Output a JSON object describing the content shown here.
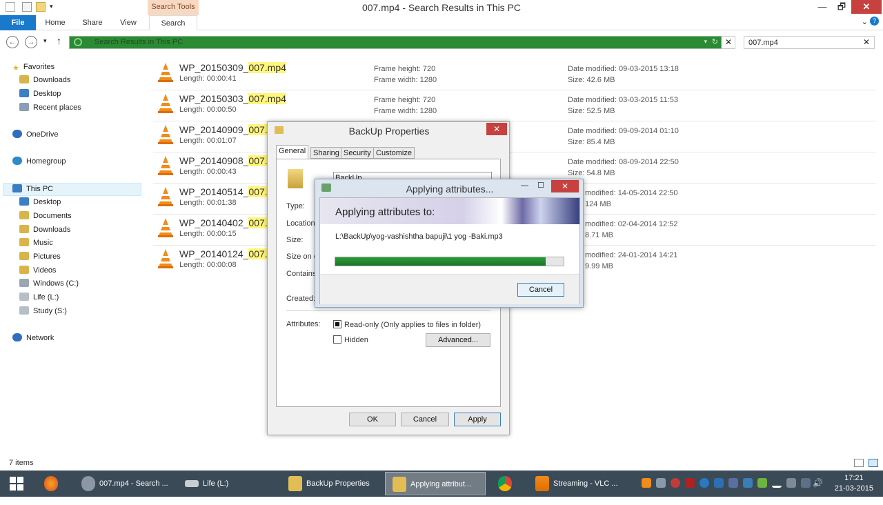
{
  "window": {
    "title": "007.mp4 - Search Results in This PC"
  },
  "ribbon": {
    "context_tab": "Search Tools",
    "tabs": [
      "File",
      "Home",
      "Share",
      "View",
      "Search"
    ]
  },
  "window_controls": {
    "minimize": "—",
    "maximize": "🗗",
    "close": "✕"
  },
  "address": {
    "path": "Search Results in This PC",
    "search_value": "007.mp4",
    "clear_glyph": "✕"
  },
  "nav": {
    "favorites": "Favorites",
    "favorites_items": [
      "Downloads",
      "Desktop",
      "Recent places"
    ],
    "onedrive": "OneDrive",
    "homegroup": "Homegroup",
    "thispc": "This PC",
    "thispc_items": [
      "Desktop",
      "Documents",
      "Downloads",
      "Music",
      "Pictures",
      "Videos",
      "Windows (C:)",
      "Life (L:)",
      "Study (S:)"
    ],
    "network": "Network"
  },
  "results": [
    {
      "name_pre": "WP_20150309_",
      "name_hl": "007.mp4",
      "length": "Length: 00:00:41",
      "frame_h": "Frame height: 720",
      "frame_w": "Frame width: 1280",
      "date": "Date modified: 09-03-2015 13:18",
      "size": "Size: 42.6 MB"
    },
    {
      "name_pre": "WP_20150303_",
      "name_hl": "007.mp4",
      "length": "Length: 00:00:50",
      "frame_h": "Frame height: 720",
      "frame_w": "Frame width: 1280",
      "date": "Date modified: 03-03-2015 11:53",
      "size": "Size: 52.5 MB"
    },
    {
      "name_pre": "WP_20140909_",
      "name_hl": "007.m",
      "length": "Length: 00:01:07",
      "frame_h": "",
      "frame_w": "",
      "date": "Date modified: 09-09-2014 01:10",
      "size": "Size: 85.4 MB"
    },
    {
      "name_pre": "WP_20140908_",
      "name_hl": "007.m",
      "length": "Length: 00:00:43",
      "frame_h": "",
      "frame_w": "",
      "date": "Date modified: 08-09-2014 22:50",
      "size": "Size: 54.8 MB"
    },
    {
      "name_pre": "WP_20140514_",
      "name_hl": "007.m",
      "length": "Length: 00:01:38",
      "frame_h": "",
      "frame_w": "",
      "date": "modified: 14-05-2014 22:50",
      "size": "124 MB"
    },
    {
      "name_pre": "WP_20140402_",
      "name_hl": "007.m",
      "length": "Length: 00:00:15",
      "frame_h": "",
      "frame_w": "",
      "date": "modified: 02-04-2014 12:52",
      "size": "8.71 MB"
    },
    {
      "name_pre": "WP_20140124_",
      "name_hl": "007.m",
      "length": "Length: 00:00:08",
      "frame_h": "",
      "frame_w": "",
      "date": "modified: 24-01-2014 14:21",
      "size": "9.99 MB"
    }
  ],
  "status": {
    "items": "7 items"
  },
  "props": {
    "title": "BackUp Properties",
    "tabs": [
      "General",
      "Sharing",
      "Security",
      "Customize"
    ],
    "name_value": "BackUp",
    "labels": {
      "type": "Type:",
      "location": "Location:",
      "size": "Size:",
      "size_on_disk": "Size on di",
      "contains": "Contains:",
      "created": "Created:",
      "attributes": "Attributes:"
    },
    "readonly": "Read-only (Only applies to files in folder)",
    "hidden": "Hidden",
    "advanced": "Advanced...",
    "ok": "OK",
    "cancel": "Cancel",
    "apply": "Apply"
  },
  "apply_dialog": {
    "title": "Applying attributes...",
    "heading": "Applying attributes to:",
    "path": "L:\\BackUp\\yog-vashishtha bapuji\\1 yog -Baki.mp3",
    "progress": 0.92,
    "cancel": "Cancel"
  },
  "taskbar": {
    "items": [
      {
        "label": "007.mp4 - Search ..."
      },
      {
        "label": "Life (L:)"
      },
      {
        "label": "BackUp Properties"
      },
      {
        "label": "Applying attribut..."
      },
      {
        "label": "Streaming - VLC ..."
      }
    ],
    "time": "17:21",
    "date": "21-03-2015"
  },
  "colors": {
    "accent": "#1979ca",
    "progress": "#2b9b38",
    "highlight": "#fff67a",
    "taskbar": "#3b4a57"
  }
}
